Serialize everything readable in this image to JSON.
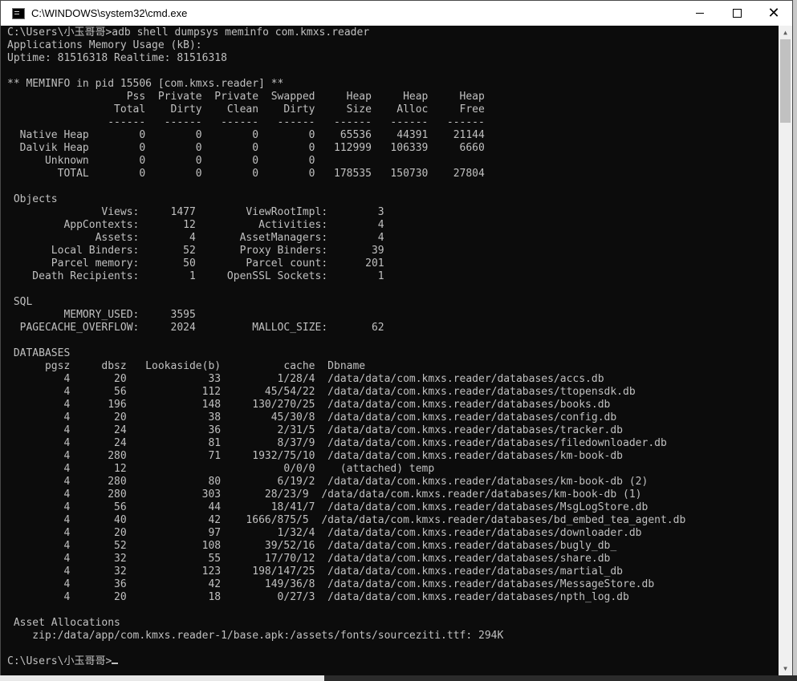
{
  "window": {
    "title": "C:\\WINDOWS\\system32\\cmd.exe",
    "icon": "cmd-icon",
    "controls": {
      "minimize": "",
      "maximize": "",
      "close": "✕"
    }
  },
  "console": {
    "lines": [
      "C:\\Users\\小玉哥哥>adb shell dumpsys meminfo com.kmxs.reader",
      "Applications Memory Usage (kB):",
      "Uptime: 81516318 Realtime: 81516318",
      "",
      "** MEMINFO in pid 15506 [com.kmxs.reader] **",
      "                   Pss  Private  Private  Swapped     Heap     Heap     Heap",
      "                 Total    Dirty    Clean    Dirty     Size    Alloc     Free",
      "                ------   ------   ------   ------   ------   ------   ------",
      "  Native Heap        0        0        0        0    65536    44391    21144",
      "  Dalvik Heap        0        0        0        0   112999   106339     6660",
      "      Unknown        0        0        0        0",
      "        TOTAL        0        0        0        0   178535   150730    27804",
      "",
      " Objects",
      "               Views:     1477        ViewRootImpl:        3",
      "         AppContexts:       12          Activities:        4",
      "              Assets:        4       AssetManagers:        4",
      "       Local Binders:       52       Proxy Binders:       39",
      "       Parcel memory:       50        Parcel count:      201",
      "    Death Recipients:        1     OpenSSL Sockets:        1",
      "",
      " SQL",
      "         MEMORY_USED:     3595",
      "  PAGECACHE_OVERFLOW:     2024         MALLOC_SIZE:       62",
      "",
      " DATABASES",
      "      pgsz     dbsz   Lookaside(b)          cache  Dbname",
      "         4       20             33         1/28/4  /data/data/com.kmxs.reader/databases/accs.db",
      "         4       56            112       45/54/22  /data/data/com.kmxs.reader/databases/ttopensdk.db",
      "         4      196            148     130/270/25  /data/data/com.kmxs.reader/databases/books.db",
      "         4       20             38        45/30/8  /data/data/com.kmxs.reader/databases/config.db",
      "         4       24             36         2/31/5  /data/data/com.kmxs.reader/databases/tracker.db",
      "         4       24             81         8/37/9  /data/data/com.kmxs.reader/databases/filedownloader.db",
      "         4      280             71     1932/75/10  /data/data/com.kmxs.reader/databases/km-book-db",
      "         4       12                         0/0/0    (attached) temp",
      "         4      280             80         6/19/2  /data/data/com.kmxs.reader/databases/km-book-db (2)",
      "         4      280            303       28/23/9  /data/data/com.kmxs.reader/databases/km-book-db (1)",
      "         4       56             44        18/41/7  /data/data/com.kmxs.reader/databases/MsgLogStore.db",
      "         4       40             42    1666/875/5  /data/data/com.kmxs.reader/databases/bd_embed_tea_agent.db",
      "         4       20             97         1/32/4  /data/data/com.kmxs.reader/databases/downloader.db",
      "         4       52            108       39/52/16  /data/data/com.kmxs.reader/databases/bugly_db_",
      "         4       32             55       17/70/12  /data/data/com.kmxs.reader/databases/share.db",
      "         4       32            123     198/147/25  /data/data/com.kmxs.reader/databases/martial_db",
      "         4       36             42       149/36/8  /data/data/com.kmxs.reader/databases/MessageStore.db",
      "         4       20             18         0/27/3  /data/data/com.kmxs.reader/databases/npth_log.db",
      "",
      " Asset Allocations",
      "    zip:/data/app/com.kmxs.reader-1/base.apk:/assets/fonts/sourceziti.ttf: 294K",
      ""
    ],
    "prompt": "C:\\Users\\小玉哥哥>"
  },
  "colors": {
    "console_bg": "#0c0c0c",
    "console_fg": "#c0c0c0",
    "titlebar_bg": "#ffffff"
  }
}
